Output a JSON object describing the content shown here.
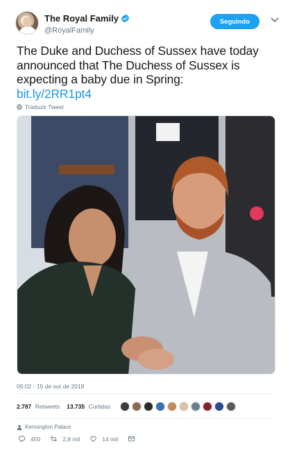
{
  "author": {
    "display_name": "The Royal Family",
    "username": "@RoyalFamily",
    "verified": true
  },
  "follow_button": {
    "label": "Seguindo"
  },
  "tweet": {
    "text": "The Duke and Duchess of Sussex have today announced that The Duchess of Sussex is expecting a baby due in Spring:",
    "link": "bit.ly/2RR1pt4",
    "translate_label": "Traduzir Tweet"
  },
  "meta": {
    "timestamp": "05:02 - 15 de out de 2018",
    "retweets_count": "2.787",
    "retweets_label": "Retweets",
    "likes_count": "13.735",
    "likes_label": "Curtidas",
    "location": "Kensington Palace"
  },
  "actions": {
    "reply_count": "450",
    "retweet_count": "2,8 mil",
    "like_count": "14 mil"
  },
  "colors": {
    "accent": "#1da1f2",
    "link": "#1b95e0",
    "muted": "#657786",
    "text": "#14171a"
  },
  "liker_avatars": [
    "#3a3a3a",
    "#8a6a55",
    "#2b2b2b",
    "#3b6fb0",
    "#c58b55",
    "#d9c2a5",
    "#6b7d8c",
    "#8a1f2d",
    "#2d4a8a",
    "#5a5a5a"
  ]
}
